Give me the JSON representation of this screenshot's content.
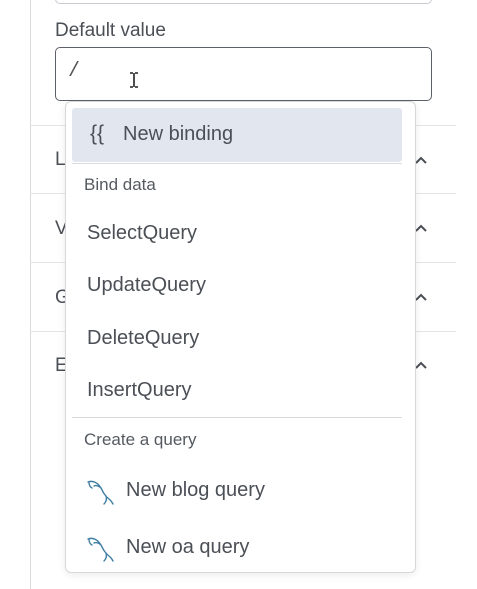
{
  "field": {
    "label": "Default value",
    "value": "/"
  },
  "sections": [
    {
      "initial": "L"
    },
    {
      "initial": "V"
    },
    {
      "initial": "G"
    },
    {
      "initial": "E"
    }
  ],
  "dropdown": {
    "new_binding": {
      "icon": "{{",
      "label": "New binding"
    },
    "bind_data_title": "Bind data",
    "queries": [
      "SelectQuery",
      "UpdateQuery",
      "DeleteQuery",
      "InsertQuery"
    ],
    "create_title": "Create a query",
    "create_items": [
      "New blog query",
      "New oa query"
    ]
  },
  "colors": {
    "highlight": "#e2e6ee",
    "text": "#4b4f56",
    "mysql_icon": "#3f7ea3"
  }
}
